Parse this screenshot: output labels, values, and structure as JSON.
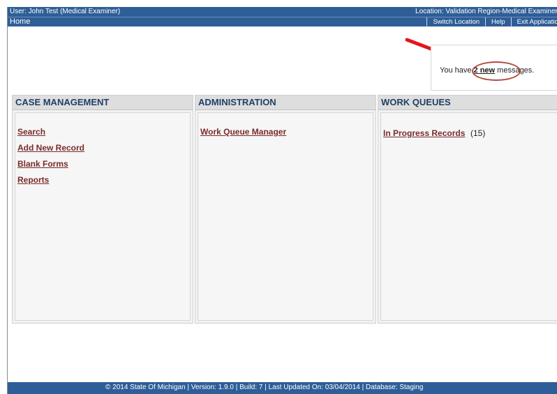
{
  "header": {
    "user": "User: John Test (Medical Examiner)",
    "location": "Location: Validation Region-Medical Examiner Offi",
    "home": "Home",
    "nav": [
      "Switch Location",
      "Help",
      "Exit Application"
    ]
  },
  "messages": {
    "prefix": "You have ",
    "link": "2 new",
    "suffix": " messages."
  },
  "panels": {
    "case": {
      "title": "CASE MANAGEMENT",
      "links": [
        "Search",
        "Add New Record",
        "Blank Forms",
        "Reports"
      ]
    },
    "admin": {
      "title": "ADMINISTRATION",
      "links": [
        "Work Queue Manager"
      ]
    },
    "queues": {
      "title": "WORK QUEUES",
      "link": "In Progress Records ",
      "count": "(15)"
    }
  },
  "footer": {
    "text": "© 2014 State Of Michigan | Version: 1.9.0 | Build: 7 | Last Updated On: 03/04/2014 | Database: Staging"
  },
  "colors": {
    "bar": "#2e5e97",
    "heading": "#1f3f66",
    "link": "#7a2a2a",
    "annotation": "#e3161e"
  }
}
